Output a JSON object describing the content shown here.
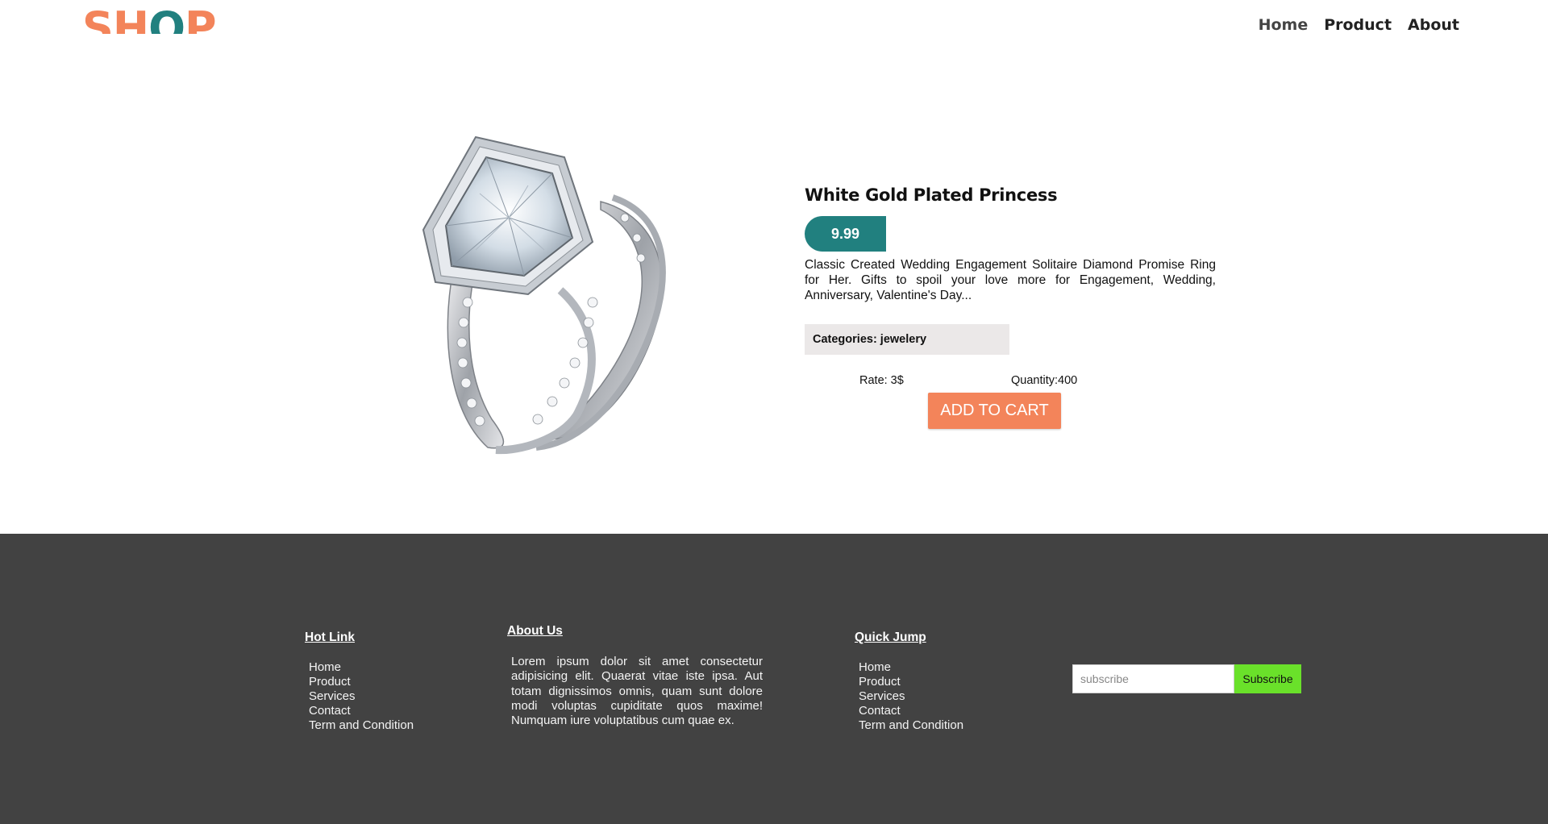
{
  "header": {
    "logo": {
      "s": "S",
      "h": "H",
      "o": "O",
      "p": "P"
    },
    "nav": [
      {
        "label": "Home"
      },
      {
        "label": "Product"
      },
      {
        "label": "About"
      }
    ]
  },
  "product": {
    "image_icon": "diamond-ring-image",
    "title": "White Gold Plated Princess",
    "price": "9.99",
    "description": "Classic Created Wedding Engagement Solitaire Diamond Promise Ring for Her. Gifts to spoil your love more for Engagement, Wedding, Anniversary, Valentine's Day...",
    "category_text": "Categories: jewelery",
    "rate_text": "Rate: 3$",
    "quantity_text": "Quantity:400",
    "cart_label": "ADD TO CART"
  },
  "footer": {
    "hot_link": {
      "heading": "Hot Link",
      "items": [
        "Home",
        "Product",
        "Services",
        "Contact",
        "Term and Condition"
      ]
    },
    "about": {
      "heading": "About Us",
      "text": "Lorem ipsum dolor sit amet consectetur adipisicing elit. Quaerat vitae iste ipsa. Aut totam dignissimos omnis, quam sunt dolore modi voluptas cupiditate quos maxime! Numquam iure voluptatibus cum quae ex."
    },
    "quick_jump": {
      "heading": "Quick Jump",
      "items": [
        "Home",
        "Product",
        "Services",
        "Contact",
        "Term and Condition"
      ]
    },
    "subscribe": {
      "placeholder": "subscribe",
      "button_label": "Subscribe"
    }
  },
  "colors": {
    "brand_orange": "#f3845a",
    "brand_teal": "#21807f",
    "footer_bg": "#424242",
    "subscribe_green": "#6ae12a",
    "category_bg": "#ebe8e8"
  }
}
